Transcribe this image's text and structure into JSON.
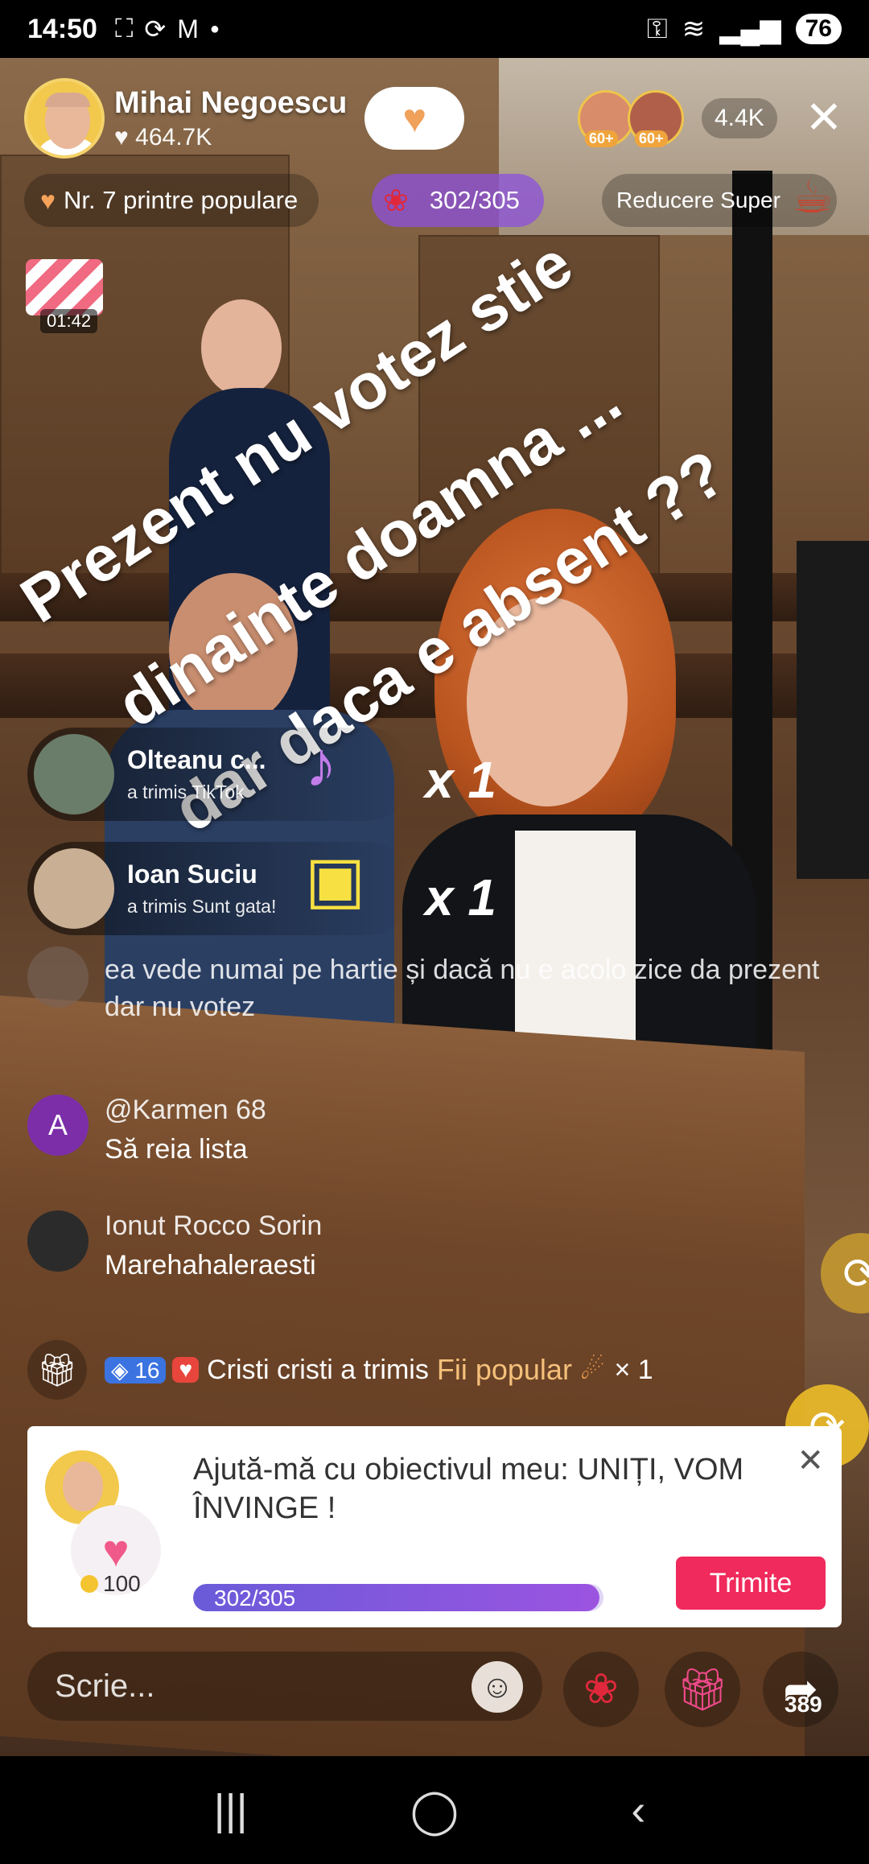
{
  "status_bar": {
    "time": "14:50",
    "left_icons": [
      "screenshot-icon",
      "sync-icon",
      "gmail-icon",
      "dot-icon"
    ],
    "right_icons": [
      "key-icon",
      "wifi-icon",
      "signal-icon",
      "signal-icon-2"
    ],
    "battery": "76"
  },
  "host": {
    "name": "Mihai Negoescu",
    "likes": "464.7K",
    "follow_badge": "1"
  },
  "viewers": {
    "top_ranks": [
      "60+",
      "60+"
    ],
    "count": "4.4K"
  },
  "pills": {
    "rank": "Nr. 7 printre populare",
    "goal": "302/305",
    "promo": "Reducere Super"
  },
  "gift_box": {
    "timer": "01:42"
  },
  "overlay_text": {
    "line1": "Prezent nu votez  stie",
    "line2": "dinainte doamna ...",
    "line3": "dar daca e absent ??"
  },
  "gift_notifications": [
    {
      "user": "Olteanu c...",
      "action": "a trimis TikTok",
      "multiplier": "x 1"
    },
    {
      "user": "Ioan Suciu",
      "action": "a trimis Sunt gata!",
      "multiplier": "x 1"
    }
  ],
  "chat": [
    {
      "user": "",
      "message": "ea vede numai pe hartie și dacă nu e acolo zice da prezent dar nu votez"
    },
    {
      "user": "@Karmen 68",
      "message": "Să reia lista",
      "avatar_letter": "A"
    },
    {
      "user": "Ionut Rocco Sorin",
      "message": "Marehahaleraesti"
    }
  ],
  "gift_system": {
    "level": "16",
    "text_before": "Cristi cristi a trimis",
    "gift_name": "Fii popular",
    "multiplier": "× 1"
  },
  "goal_card": {
    "title": "Ajută-mă cu obiectivul meu: UNIȚI, VOM ÎNVINGE !",
    "coins": "100",
    "progress_text": "302/305",
    "progress": 0.99,
    "send_label": "Trimite"
  },
  "bottom_bar": {
    "comment_placeholder": "Scrie...",
    "share_count": "389"
  },
  "colors": {
    "accent_pink": "#f02a5c",
    "goal_purple": "#8c50dc",
    "gold": "#f5d36b"
  }
}
